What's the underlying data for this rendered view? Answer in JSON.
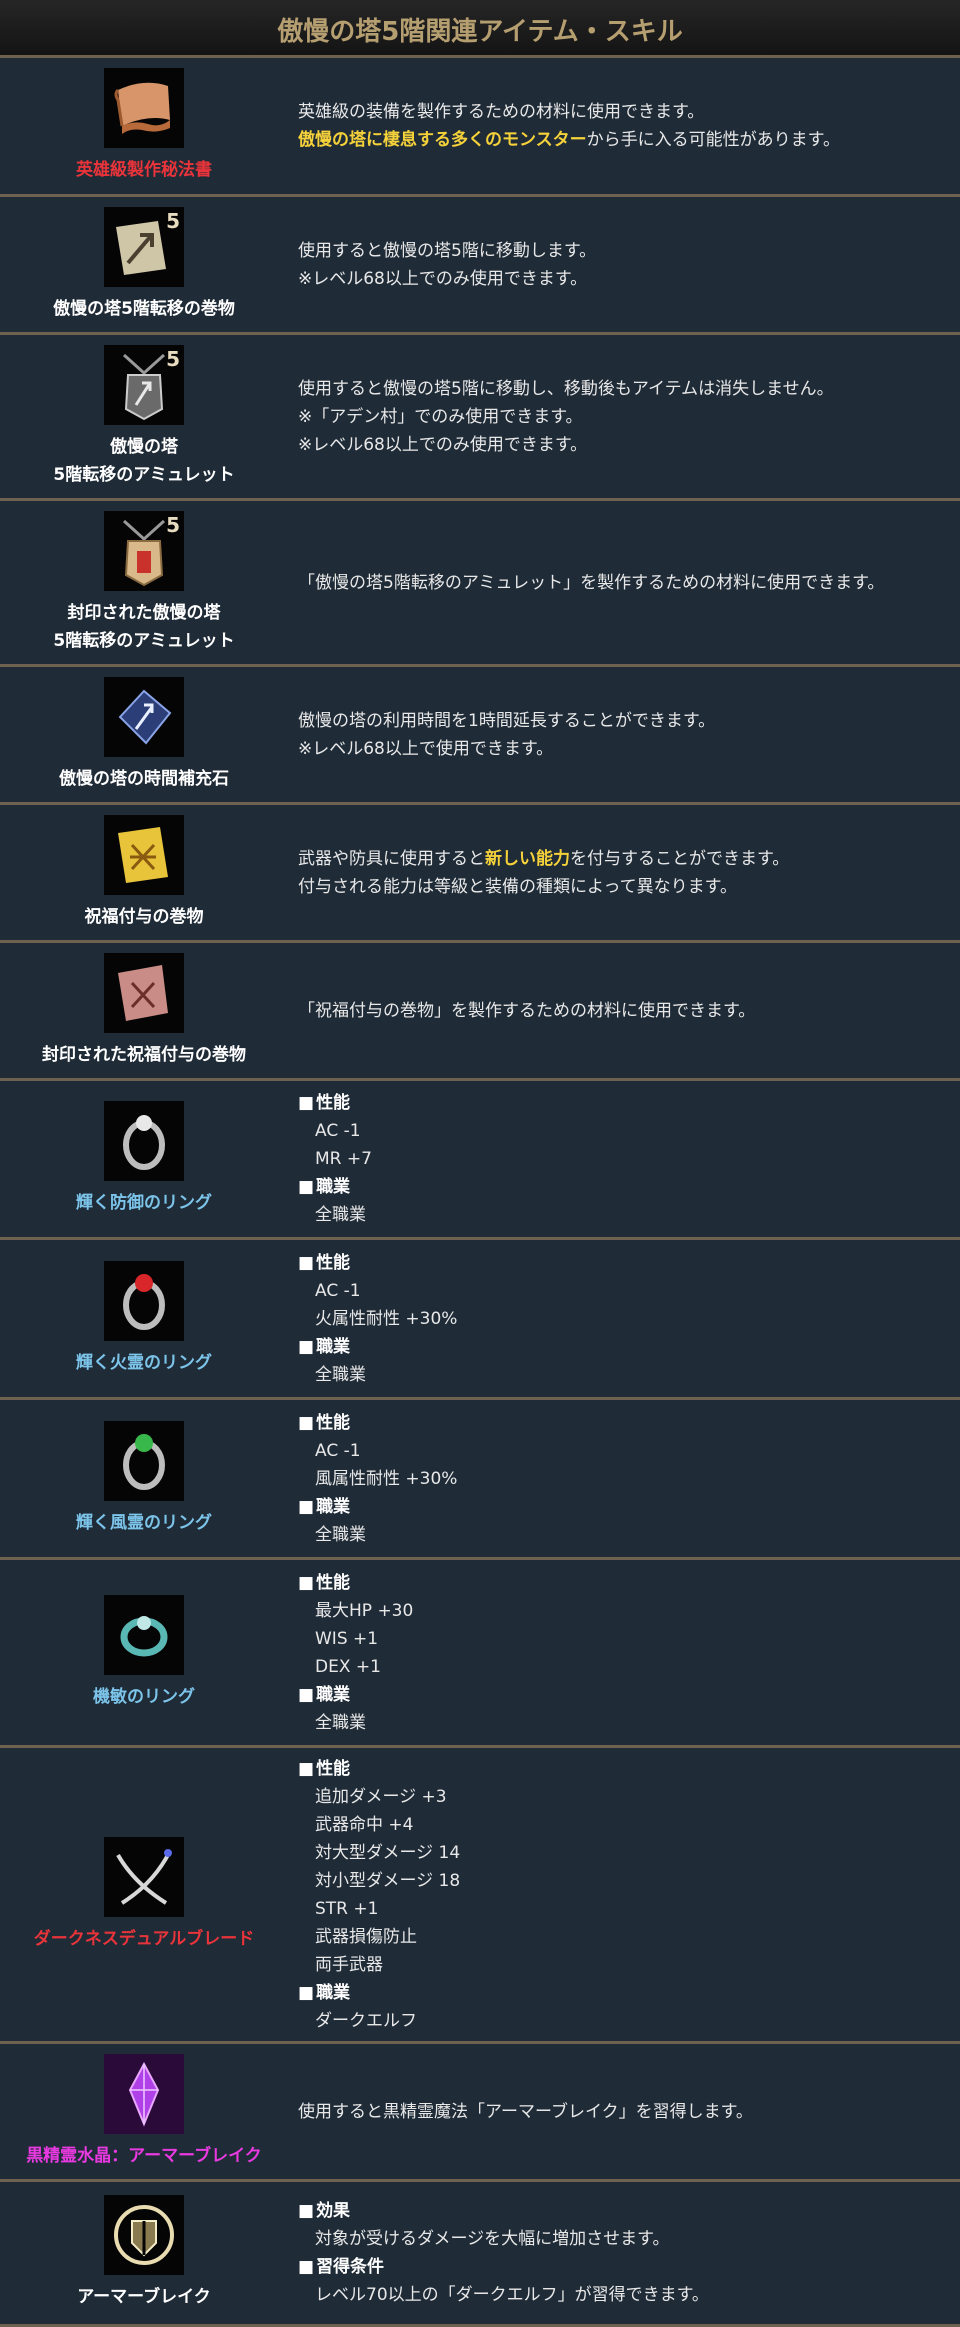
{
  "page_title": "傲慢の塔5階関連アイテム・スキル",
  "items": [
    {
      "name": "英雄級製作秘法書",
      "icon": "scroll-parchment-icon",
      "lines": [
        "英雄級の装備を製作するための材料に使用できます。",
        {
          "hl": "傲慢の塔に棲息する多くのモンスター",
          "rest": "から手に入る可能性があります。"
        }
      ]
    },
    {
      "name": "傲慢の塔5階転移の巻物",
      "icon": "teleport-scroll-icon",
      "badge": "5",
      "lines": [
        "使用すると傲慢の塔5階に移動します。",
        "※レベル68以上でのみ使用できます。"
      ]
    },
    {
      "name": "傲慢の塔\n5階転移のアミュレット",
      "icon": "amulet-icon",
      "badge": "5",
      "lines": [
        "使用すると傲慢の塔5階に移動し、移動後もアイテムは消失しません。",
        "※「アデン村」でのみ使用できます。",
        "※レベル68以上でのみ使用できます。"
      ]
    },
    {
      "name": "封印された傲慢の塔\n5階転移のアミュレット",
      "icon": "sealed-amulet-icon",
      "badge": "5",
      "lines": [
        "「傲慢の塔5階転移のアミュレット」を製作するための材料に使用できます。"
      ]
    },
    {
      "name": "傲慢の塔の時間補充石",
      "icon": "time-stone-icon",
      "lines": [
        "傲慢の塔の利用時間を1時間延長することができます。",
        "※レベル68以上で使用できます。"
      ]
    },
    {
      "name": "祝福付与の巻物",
      "icon": "blessing-scroll-icon",
      "lines": [
        {
          "pre": "武器や防具に使用すると",
          "hl": "新しい能力",
          "rest": "を付与することができます。"
        },
        "付与される能力は等級と装備の種類によって異なります。"
      ]
    },
    {
      "name": "封印された祝福付与の巻物",
      "icon": "sealed-blessing-scroll-icon",
      "lines": [
        "「祝福付与の巻物」を製作するための材料に使用できます。"
      ]
    },
    {
      "name": "輝く防御のリング",
      "icon": "defense-ring-icon",
      "spec": [
        {
          "head": "性能",
          "vals": [
            "AC -1",
            "MR +7"
          ]
        },
        {
          "head": "職業",
          "vals": [
            "全職業"
          ]
        }
      ]
    },
    {
      "name": "輝く火霊のリング",
      "icon": "fire-ring-icon",
      "spec": [
        {
          "head": "性能",
          "vals": [
            "AC -1",
            "火属性耐性 +30%"
          ]
        },
        {
          "head": "職業",
          "vals": [
            "全職業"
          ]
        }
      ]
    },
    {
      "name": "輝く風霊のリング",
      "icon": "wind-ring-icon",
      "spec": [
        {
          "head": "性能",
          "vals": [
            "AC -1",
            "風属性耐性 +30%"
          ]
        },
        {
          "head": "職業",
          "vals": [
            "全職業"
          ]
        }
      ]
    },
    {
      "name": "機敏のリング",
      "icon": "agility-ring-icon",
      "spec": [
        {
          "head": "性能",
          "vals": [
            "最大HP +30",
            "WIS +1",
            "DEX +1"
          ]
        },
        {
          "head": "職業",
          "vals": [
            "全職業"
          ]
        }
      ]
    },
    {
      "name": "ダークネスデュアルブレード",
      "icon": "dual-blade-icon",
      "spec": [
        {
          "head": "性能",
          "vals": [
            "追加ダメージ +3",
            "武器命中 +4",
            "対大型ダメージ 14",
            "対小型ダメージ 18",
            "STR +1",
            "武器損傷防止",
            "両手武器"
          ]
        },
        {
          "head": "職業",
          "vals": [
            "ダークエルフ"
          ]
        }
      ]
    },
    {
      "name": "黒精霊水晶：アーマーブレイク",
      "icon": "dark-crystal-icon",
      "lines": [
        "使用すると黒精霊魔法「アーマーブレイク」を習得します。"
      ]
    },
    {
      "name": "アーマーブレイク",
      "icon": "armor-break-skill-icon",
      "spec": [
        {
          "head": "効果",
          "vals": [
            "対象が受けるダメージを大幅に増加させます。"
          ]
        },
        {
          "head": "習得条件",
          "vals": [
            "レベル70以上の「ダークエルフ」が習得できます。"
          ]
        }
      ]
    }
  ]
}
